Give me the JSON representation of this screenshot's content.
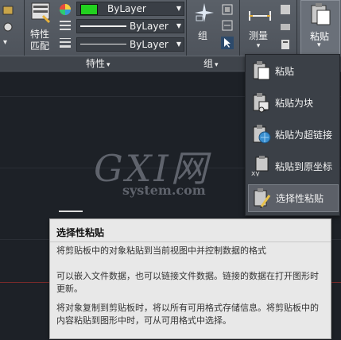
{
  "ribbon": {
    "properties_panel": {
      "match_label": "特性\n匹配",
      "color_value": "ByLayer",
      "color_swatch": "#22d11f",
      "linetype_value": "ByLayer",
      "lineweight_value": "ByLayer",
      "group_label": "特性",
      "group_arrow": "▾"
    },
    "group_panel": {
      "group_button_label": "组",
      "group_label": "组",
      "group_arrow": "▾"
    },
    "utilities_panel": {
      "measure_label": "测量",
      "measure_arrow": "▾"
    },
    "clipboard_panel": {
      "paste_label": "粘贴",
      "paste_arrow": "▾"
    }
  },
  "paste_menu": {
    "items": [
      {
        "label": "粘贴",
        "icon": "paste-icon"
      },
      {
        "label": "粘贴为块",
        "icon": "paste-as-block-icon"
      },
      {
        "label": "粘贴为超链接",
        "icon": "paste-as-hyperlink-icon"
      },
      {
        "label": "粘贴到原坐标",
        "icon": "paste-to-original-coordinates-icon"
      },
      {
        "label": "选择性粘贴",
        "icon": "paste-special-icon"
      }
    ],
    "selected_index": 4
  },
  "tooltip": {
    "title": "选择性粘贴",
    "line1": "将剪贴板中的对象粘贴到当前视图中并控制数据的格式",
    "line2": "可以嵌入文件数据，也可以链接文件数据。链接的数据在打开图形时更新。",
    "line3": "将对象复制到剪贴板时，将以所有可用格式存储信息。将剪贴板中的内容粘贴到图形中时，可从可用格式中选择。"
  },
  "watermark": {
    "logo": "GXI网",
    "domain": "system.com"
  },
  "colors": {
    "ribbon_bg": "#50555c",
    "menu_bg": "#3b4047",
    "selected_bg": "#5c6068",
    "tooltip_bg": "#e8e8e8",
    "canvas_bg": "#1d2127"
  }
}
